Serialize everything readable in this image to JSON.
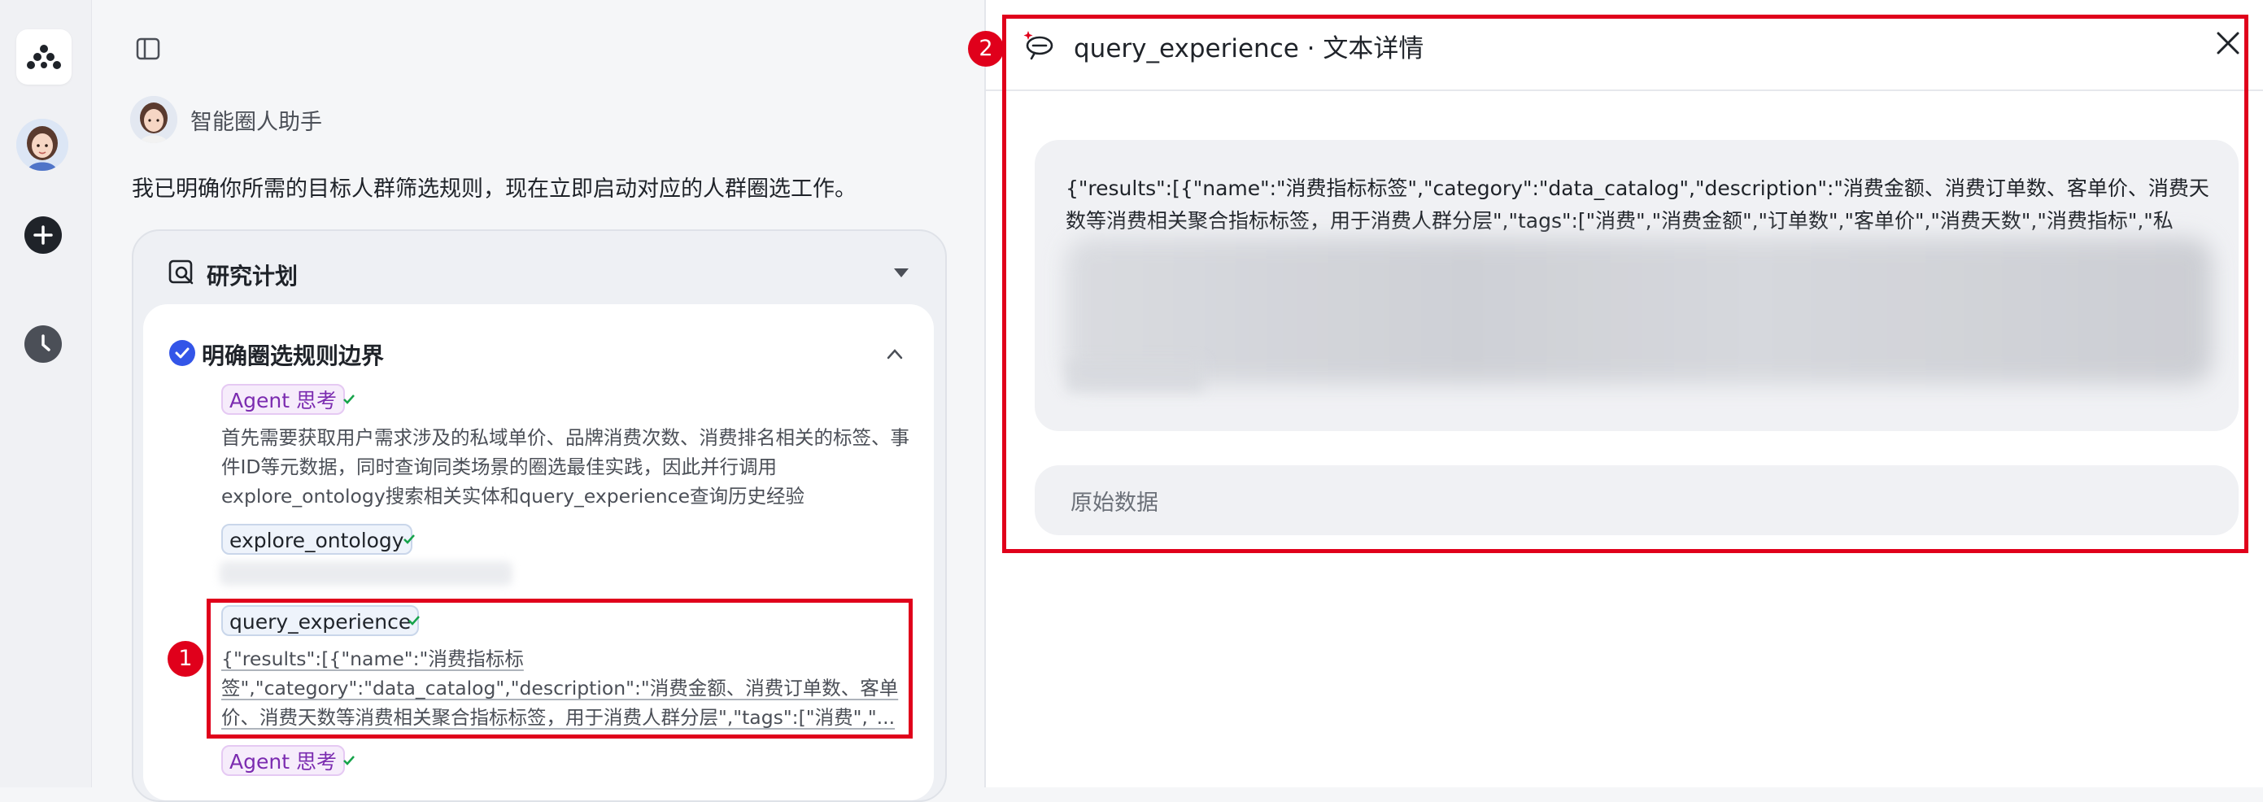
{
  "chat": {
    "agent_name": "智能圈人助手",
    "intro": "我已明确你所需的目标人群筛选规则，现在立即启动对应的人群圈选工作。",
    "plan": {
      "title": "研究计划",
      "step": {
        "title": "明确圈选规则边界",
        "events": [
          {
            "tag": "Agent 思考",
            "text": "首先需要获取用户需求涉及的私域单价、品牌消费次数、消费排名相关的标签、事件ID等元数据，同时查询同类场景的圈选最佳实践，因此并行调用explore_ontology搜索相关实体和query_experience查询历史经验"
          },
          {
            "tag": "explore_ontology"
          },
          {
            "tag": "query_experience",
            "text": "{\"results\":[{\"name\":\"消费指标标签\",\"category\":\"data_catalog\",\"description\":\"消费金额、消费订单数、客单价、消费天数等消费相关聚合指标标签，用于消费人群分层\",\"tags\":[\"消费\",\"..."
          },
          {
            "tag": "Agent 思考"
          }
        ]
      }
    },
    "annotation_1": "1"
  },
  "detail": {
    "title": "query_experience · 文本详情",
    "json_text": "{\"results\":[{\"name\":\"消费指标标签\",\"category\":\"data_catalog\",\"description\":\"消费金额、消费订单数、客单价、消费天数等消费相关聚合指标标签，用于消费人群分层\",\"tags\":[\"消费\",\"消费金额\",\"订单数\",\"客单价\",\"消费天数\",\"消费指标\",\"私",
    "raw_label": "原始数据",
    "annotation_2": "2"
  },
  "colors": {
    "highlight": "#e0001b",
    "agent_tag": "#7b2bb0",
    "check_blue": "#3355e8",
    "ok_green": "#16a34a"
  },
  "icons": {
    "logo": "brand-logo-icon",
    "rail_avatar": "user-avatar",
    "add": "plus-icon",
    "history": "clock-icon",
    "sidebar_toggle": "sidebar-toggle-icon",
    "plan": "search-document-icon",
    "close": "close-icon"
  }
}
